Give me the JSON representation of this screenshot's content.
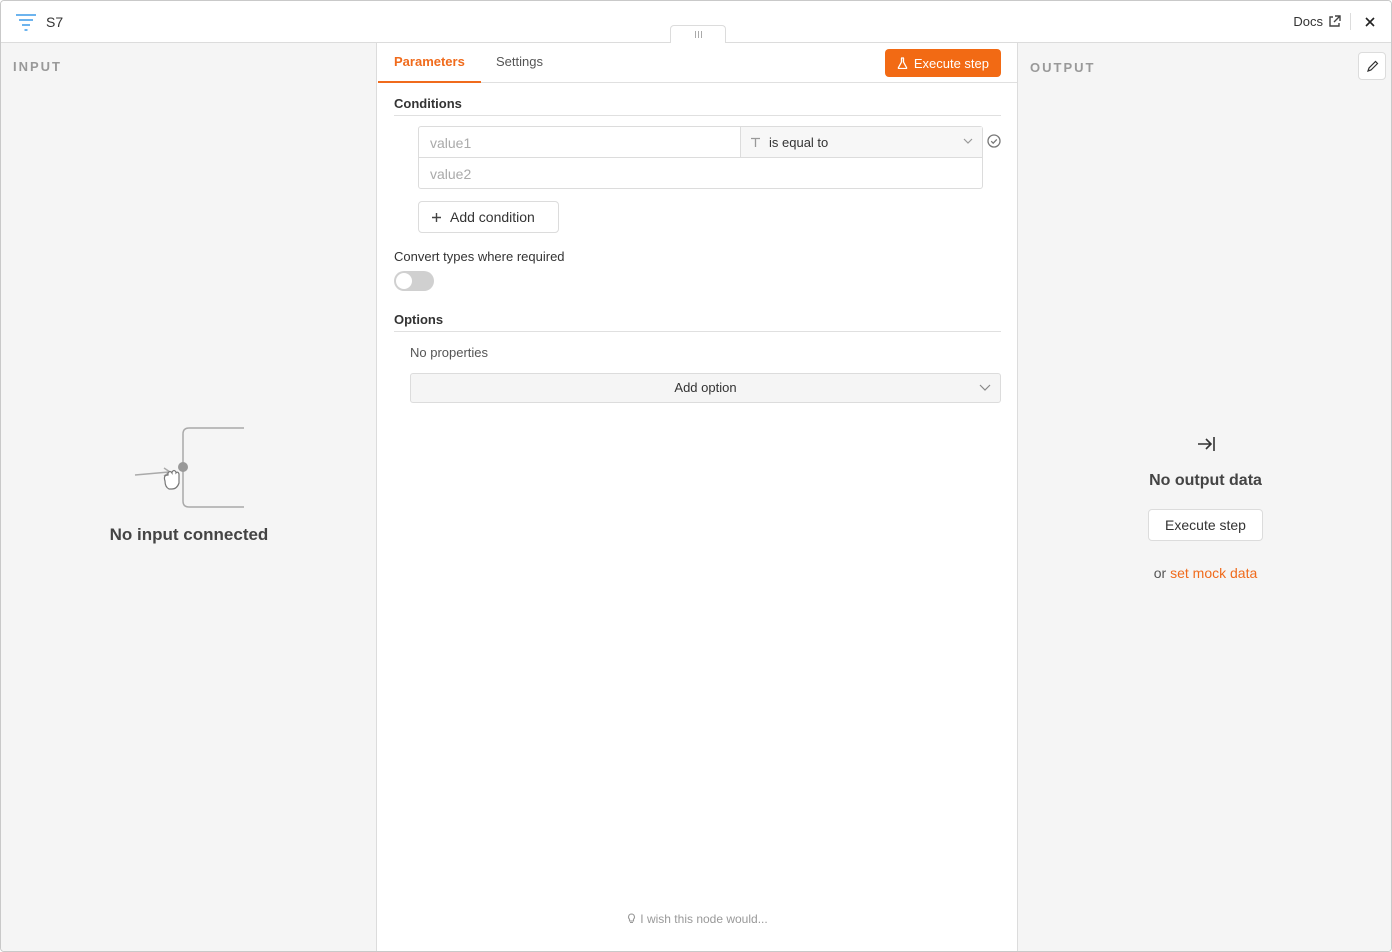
{
  "header": {
    "node_title": "S7",
    "docs_label": "Docs"
  },
  "input_panel": {
    "label": "INPUT",
    "empty_text": "No input connected"
  },
  "tabs": [
    {
      "label": "Parameters",
      "active": true
    },
    {
      "label": "Settings",
      "active": false
    }
  ],
  "execute_button": {
    "label": "Execute step"
  },
  "conditions": {
    "title": "Conditions",
    "value1_placeholder": "value1",
    "operator": "is equal to",
    "value2_placeholder": "value2",
    "add_label": "Add condition"
  },
  "convert": {
    "label": "Convert types where required",
    "enabled": false
  },
  "options": {
    "title": "Options",
    "no_properties": "No properties",
    "add_label": "Add option"
  },
  "wish_text": "I wish this node would...",
  "output_panel": {
    "label": "OUTPUT",
    "empty_title": "No output data",
    "exec_label": "Execute step",
    "or_text": "or",
    "mock_link": "set mock data"
  },
  "colors": {
    "accent": "#f26a14",
    "panel_bg": "#f5f5f5",
    "node_icon": "#3d9be9"
  }
}
